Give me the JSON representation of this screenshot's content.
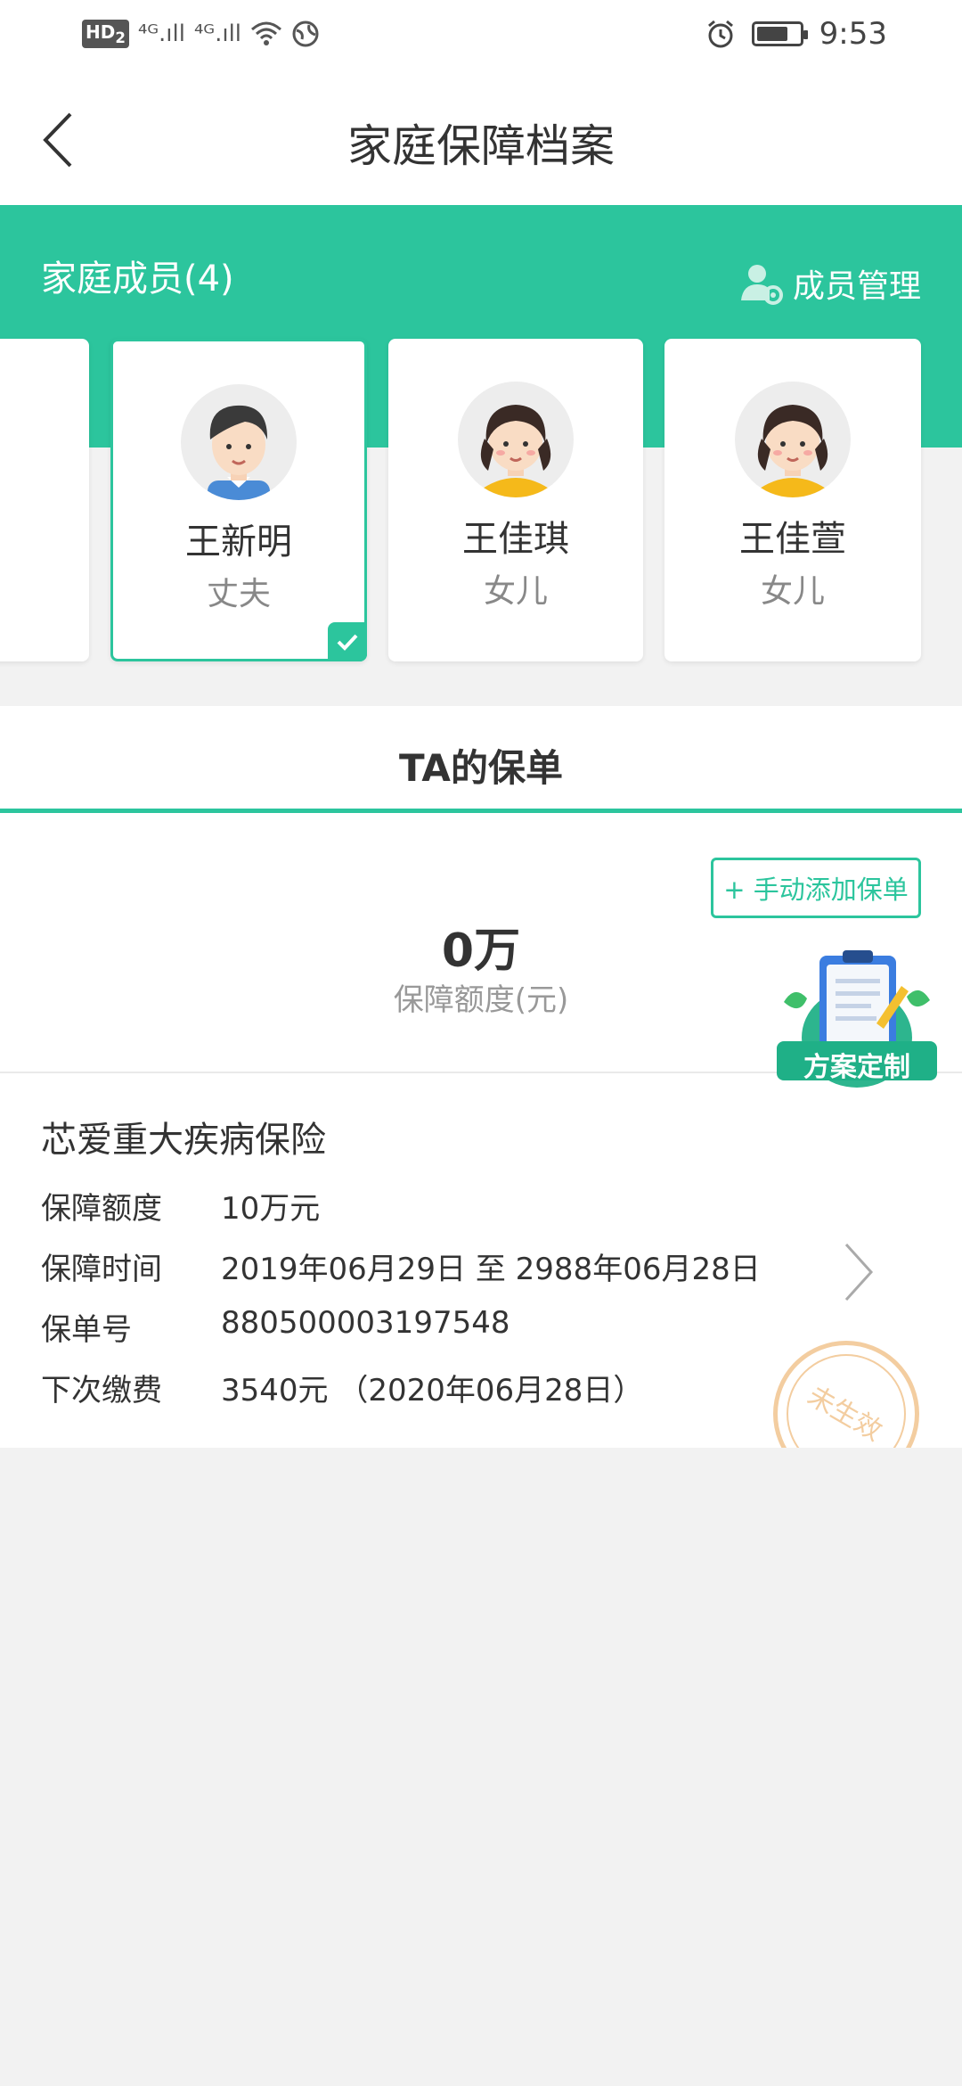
{
  "status_bar": {
    "hd": "HD",
    "hd_sub": "2",
    "net1": "⁴ᴳ.ıll",
    "net2": "⁴ᴳ.ıll",
    "time": "9:53"
  },
  "nav": {
    "title": "家庭保障档案"
  },
  "members": {
    "title": "家庭成员(4)",
    "manage_label": "成员管理",
    "cards": [
      {
        "name": "王新明",
        "relation": "丈夫",
        "avatar": "male-avatar-icon",
        "selected": true
      },
      {
        "name": "王佳琪",
        "relation": "女儿",
        "avatar": "girl-avatar-icon",
        "selected": false
      },
      {
        "name": "王佳萱",
        "relation": "女儿",
        "avatar": "girl-avatar-icon",
        "selected": false
      }
    ]
  },
  "tab": {
    "label": "TA的保单"
  },
  "summary": {
    "add_button": "+ 手动添加保单",
    "amount": "0万",
    "amount_label": "保障额度(元)",
    "plan_badge": "方案定制"
  },
  "policy": {
    "name": "芯爱重大疾病保险",
    "rows": [
      {
        "key": "保障额度",
        "value": "10万元"
      },
      {
        "key": "保障时间",
        "value": "2019年06月29日 至 2988年06月28日"
      },
      {
        "key": "保单号",
        "value": "880500003197548"
      },
      {
        "key": "下次缴费",
        "value": "3540元 （2020年06月28日）"
      }
    ],
    "stamp": "未生效"
  },
  "colors": {
    "accent": "#2cc59d",
    "stamp": "#f3cda0"
  }
}
